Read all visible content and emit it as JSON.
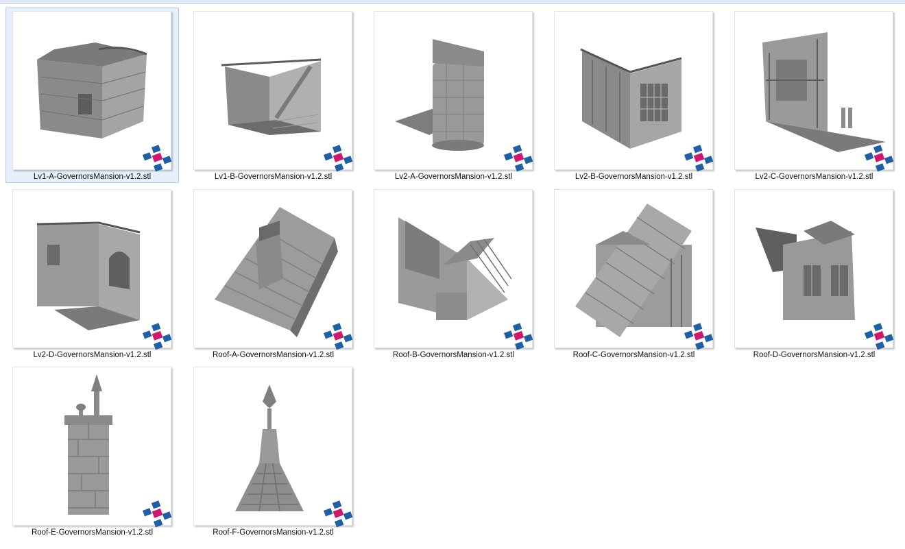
{
  "files": [
    {
      "name": "Lv1-A-GovernorsMansion-v1.2.stl",
      "selected": true
    },
    {
      "name": "Lv1-B-GovernorsMansion-v1.2.stl",
      "selected": false
    },
    {
      "name": "Lv2-A-GovernorsMansion-v1.2.stl",
      "selected": false
    },
    {
      "name": "Lv2-B-GovernorsMansion-v1.2.stl",
      "selected": false
    },
    {
      "name": "Lv2-C-GovernorsMansion-v1.2.stl",
      "selected": false
    },
    {
      "name": "Lv2-D-GovernorsMansion-v1.2.stl",
      "selected": false
    },
    {
      "name": "Roof-A-GovernorsMansion-v1.2.stl",
      "selected": false
    },
    {
      "name": "Roof-B-GovernorsMansion-v1.2.stl",
      "selected": false
    },
    {
      "name": "Roof-C-GovernorsMansion-v1.2.stl",
      "selected": false
    },
    {
      "name": "Roof-D-GovernorsMansion-v1.2.stl",
      "selected": false
    },
    {
      "name": "Roof-E-GovernorsMansion-v1.2.stl",
      "selected": false
    },
    {
      "name": "Roof-F-GovernorsMansion-v1.2.stl",
      "selected": false
    }
  ],
  "icons": {
    "file_type_badge": "stl-file-type-icon"
  },
  "colors": {
    "model_gray": "#8e8e8e",
    "selection_bg": "#e5f0fb",
    "badge_blue": "#1f5fa6",
    "badge_magenta": "#d1186f"
  }
}
